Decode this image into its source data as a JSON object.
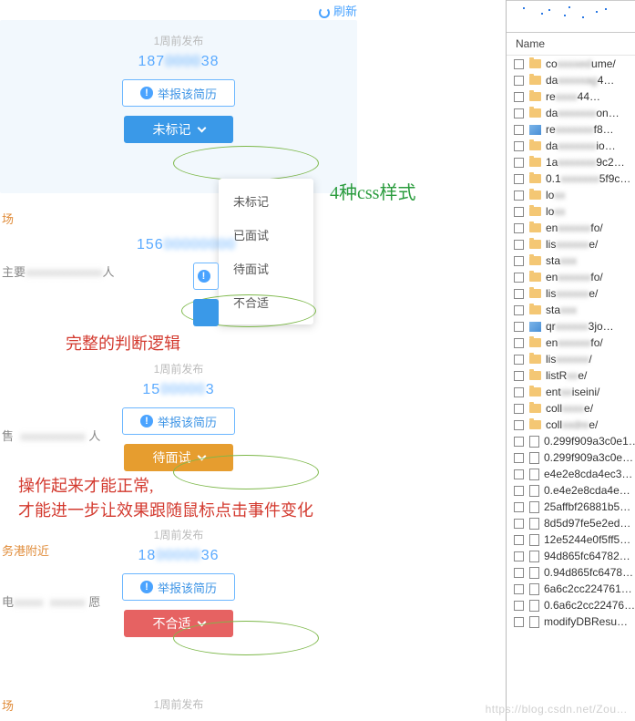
{
  "refresh_label": "刷新",
  "pub_time": "1周前发布",
  "card1": {
    "phone_prefix": "187",
    "phone_mid": "0000",
    "phone_suffix": "38"
  },
  "report_label": "举报该简历",
  "tag_unmarked": "未标记",
  "tag_pending": "待面试",
  "tag_unfit": "不合适",
  "dropdown": [
    "未标记",
    "已面试",
    "待面试",
    "不合适"
  ],
  "anno_green": "4种css样式",
  "anno_red1": "完整的判断逻辑",
  "anno_red2_l1": "操作起来才能正常,",
  "anno_red2_l2": "才能进一步让效果跟随鼠标点击事件变化",
  "card2a": {
    "phone_prefix": "156",
    "phone_rest": "00000000"
  },
  "side_zhu": "主要",
  "side_ren": "人",
  "side_chang": "场",
  "side_chang2": "场",
  "card3": {
    "phone_prefix": "15",
    "phone_mid": "00000",
    "phone_suffix": "3"
  },
  "side_shou": "售",
  "side_ren2": "人",
  "card4": {
    "phone_prefix": "18",
    "phone_mid": "00000",
    "phone_suffix": "36"
  },
  "side_gang": "务港附近",
  "side_dian": "电",
  "side_yuan": "愿",
  "panel_hdr": "Name",
  "files": [
    {
      "t": "folder",
      "pre": "co",
      "blur": "xxxxed",
      "suf": "ume/"
    },
    {
      "t": "folder",
      "pre": "da",
      "blur": "xxxxxag",
      "suf": "4…"
    },
    {
      "t": "folder",
      "pre": "re",
      "blur": "xxxx",
      "suf": "44…"
    },
    {
      "t": "folder",
      "pre": "da",
      "blur": "xxxxxxx",
      "suf": "on…"
    },
    {
      "t": "img",
      "pre": "re",
      "blur": "xxxxxxx",
      "suf": "f8…"
    },
    {
      "t": "folder",
      "pre": "da",
      "blur": "xxxxxxx",
      "suf": "io…"
    },
    {
      "t": "folder",
      "pre": "1a",
      "blur": "xxxxxxx",
      "suf": "9c2…"
    },
    {
      "t": "folder",
      "pre": "0.1",
      "blur": "xxxxxxx",
      "suf": "5f9c…"
    },
    {
      "t": "folder",
      "pre": "lo",
      "blur": "xx",
      "suf": ""
    },
    {
      "t": "folder",
      "pre": "lo",
      "blur": "xx",
      "suf": ""
    },
    {
      "t": "folder",
      "pre": "en",
      "blur": "xxxxxx",
      "suf": "fo/"
    },
    {
      "t": "folder",
      "pre": "lis",
      "blur": "xxxxxx",
      "suf": "e/"
    },
    {
      "t": "folder",
      "pre": "sta",
      "blur": "xxx",
      "suf": ""
    },
    {
      "t": "folder",
      "pre": "en",
      "blur": "xxxxxx",
      "suf": "fo/"
    },
    {
      "t": "folder",
      "pre": "lis",
      "blur": "xxxxxx",
      "suf": "e/"
    },
    {
      "t": "folder",
      "pre": "sta",
      "blur": "xxx",
      "suf": ""
    },
    {
      "t": "img",
      "pre": "qr",
      "blur": "xxxxxx",
      "suf": "3jo…"
    },
    {
      "t": "folder",
      "pre": "en",
      "blur": "xxxxxx",
      "suf": "fo/"
    },
    {
      "t": "folder",
      "pre": "lis",
      "blur": "xxxxxx",
      "suf": "/"
    },
    {
      "t": "folder",
      "pre": "listR",
      "blur": "xx",
      "suf": "e/"
    },
    {
      "t": "folder",
      "pre": "ent",
      "blur": "xx",
      "suf": "iseini/"
    },
    {
      "t": "folder",
      "pre": "coll",
      "blur": "xxxx",
      "suf": "e/"
    },
    {
      "t": "folder",
      "pre": "coll",
      "blur": "xxdre",
      "suf": "e/"
    },
    {
      "t": "file",
      "pre": "0.",
      "blur": "",
      "suf": "299f909a3c0e1…"
    },
    {
      "t": "file",
      "pre": "",
      "blur": "",
      "suf": "0.299f909a3c0e…"
    },
    {
      "t": "file",
      "pre": "",
      "blur": "",
      "suf": "e4e2e8cda4ec3…"
    },
    {
      "t": "file",
      "pre": "",
      "blur": "",
      "suf": "0.e4e2e8cda4e…"
    },
    {
      "t": "file",
      "pre": "",
      "blur": "",
      "suf": "25affbf26881b5…"
    },
    {
      "t": "file",
      "pre": "",
      "blur": "",
      "suf": "8d5d97fe5e2ed…"
    },
    {
      "t": "file",
      "pre": "",
      "blur": "",
      "suf": "12e5244e0f5ff5…"
    },
    {
      "t": "file",
      "pre": "",
      "blur": "",
      "suf": "94d865fc64782…"
    },
    {
      "t": "file",
      "pre": "",
      "blur": "",
      "suf": "0.94d865fc6478…"
    },
    {
      "t": "file",
      "pre": "",
      "blur": "",
      "suf": "6a6c2cc224761…"
    },
    {
      "t": "file",
      "pre": "",
      "blur": "",
      "suf": "0.6a6c2cc22476…"
    },
    {
      "t": "file",
      "pre": "",
      "blur": "",
      "suf": "modifyDBResu…"
    }
  ],
  "watermark": "https://blog.csdn.net/Zou…"
}
